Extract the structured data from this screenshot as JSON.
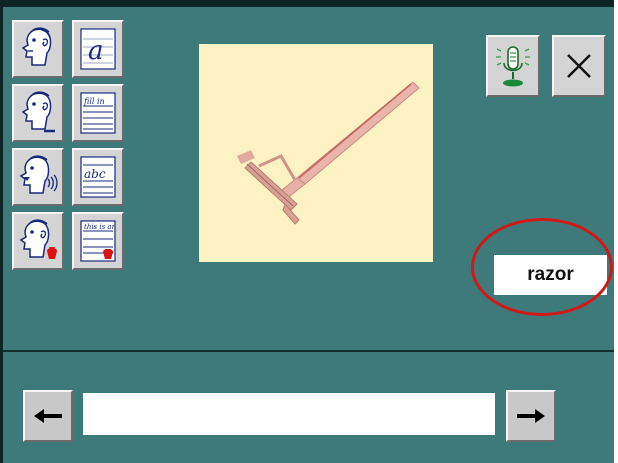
{
  "toolbar": {
    "tools": [
      {
        "name": "listen-face",
        "icon": "face-listen-icon"
      },
      {
        "name": "letter-a",
        "icon": "cursive-a-icon",
        "label": "a"
      },
      {
        "name": "speak-face",
        "icon": "face-speak-icon"
      },
      {
        "name": "fill-in",
        "icon": "fill-in-icon",
        "label": "fill in"
      },
      {
        "name": "speak-out-face",
        "icon": "face-soundwave-icon"
      },
      {
        "name": "abc",
        "icon": "abc-icon",
        "label": "abc"
      },
      {
        "name": "record-face",
        "icon": "face-record-icon"
      },
      {
        "name": "this-is-an",
        "icon": "this-is-an-icon",
        "label": "this is an"
      }
    ]
  },
  "picture": {
    "subject": "razor-image"
  },
  "controls": {
    "microphone_icon": "microphone-icon",
    "close_icon": "close-icon"
  },
  "word": {
    "text": "razor"
  },
  "answer": {
    "value": "",
    "placeholder": ""
  },
  "nav": {
    "prev_symbol": "🡐",
    "next_symbol": "🡒"
  },
  "colors": {
    "background": "#3f7a7a",
    "button": "#d4d4d4",
    "picture_bg": "#fdf2c3",
    "highlight": "#d01818"
  }
}
